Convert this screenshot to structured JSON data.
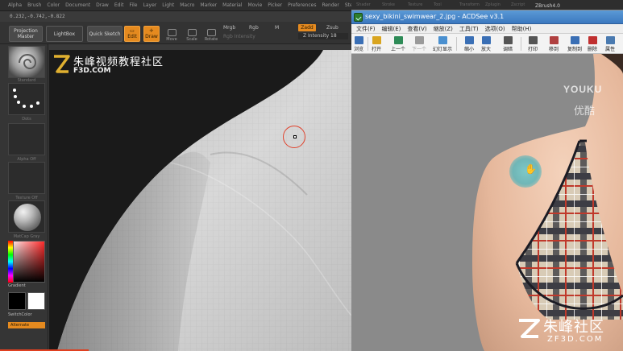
{
  "zbrush": {
    "menu": [
      "Alpha",
      "Brush",
      "Color",
      "Document",
      "Draw",
      "Edit",
      "File",
      "Layer",
      "Light",
      "Macro",
      "Marker",
      "Material",
      "Movie",
      "Picker",
      "Preferences",
      "Render",
      "Stencil"
    ],
    "coords": "0.232,-0.742,-0.822",
    "projection_master": "Projection Master",
    "lightbox": "LightBox",
    "quick_sketch": "Quick Sketch",
    "edit": "Edit",
    "draw": "Draw",
    "move": "Move",
    "scale": "Scale",
    "rotate": "Rotate",
    "mrgb": "Mrgb",
    "rgb": "Rgb",
    "m": "M",
    "zadd": "Zadd",
    "zsub": "Zsub",
    "rgb_intensity": "Rgb Intensity",
    "z_intensity": "Z Intensity 18",
    "shelf": {
      "brush_caption": "Standard",
      "stroke_caption": "Dots",
      "alpha_caption": "Alpha Off",
      "texture_caption": "Texture Off",
      "material_caption": "MatCap Gray",
      "gradient": "Gradient",
      "switch_color": "SwitchColor",
      "alternate": "Alternate"
    },
    "canvas": {
      "logo_title": "朱峰视频教程社区",
      "logo_sub": "F3D.COM"
    }
  },
  "acdsee": {
    "background_strip": [
      "Shader",
      "Stroke",
      "Texture",
      "Tool",
      "Transform",
      "Zplugin",
      "Zscript"
    ],
    "zbrush_title": "ZBrush4.0",
    "window_title": "sexy_bikini_swimwear_2.jpg - ACDSee v3.1",
    "menu": [
      "文件(F)",
      "编辑(E)",
      "查看(V)",
      "缩放(Z)",
      "工具(T)",
      "选项(O)",
      "帮助(H)"
    ],
    "toolbar": [
      "浏览",
      "打开",
      "上一个",
      "下一个",
      "幻灯显示",
      "缩小",
      "放大",
      "调暗",
      "打印",
      "移到",
      "复制到",
      "删除",
      "属性"
    ],
    "watermark_top": "YOUKU",
    "watermark_top_sub": "优酷",
    "watermark_brand": "朱峰社区",
    "watermark_url": "ZF3D.COM"
  },
  "colors": {
    "zbrush_accent": "#e58a1f",
    "acdsee_title": "#3b78bf",
    "cursor_red": "#e0422c"
  }
}
